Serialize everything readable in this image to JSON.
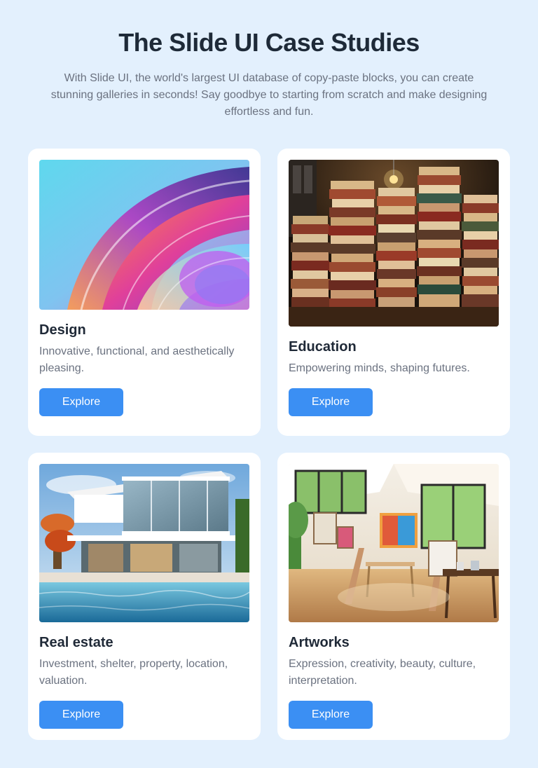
{
  "header": {
    "title": "The Slide UI Case Studies",
    "subtitle": "With Slide UI, the world's largest UI database of copy-paste blocks, you can create stunning galleries in seconds! Say goodbye to starting from scratch and make designing effortless and fun."
  },
  "cards": [
    {
      "title": "Design",
      "description": "Innovative, functional, and aesthetically pleasing.",
      "button_label": "Explore",
      "image": "abstract-glass-swirl"
    },
    {
      "title": "Education",
      "description": "Empowering minds, shaping futures.",
      "button_label": "Explore",
      "image": "stacked-books"
    },
    {
      "title": "Real estate",
      "description": "Investment, shelter, property, location, valuation.",
      "button_label": "Explore",
      "image": "modern-house-pool"
    },
    {
      "title": "Artworks",
      "description": "Expression, creativity, beauty, culture, interpretation.",
      "button_label": "Explore",
      "image": "art-studio"
    }
  ],
  "colors": {
    "page_background": "#e3f0fd",
    "card_background": "#ffffff",
    "button": "#3b8ff3",
    "title": "#1e2a38",
    "body_text": "#6b7280"
  }
}
